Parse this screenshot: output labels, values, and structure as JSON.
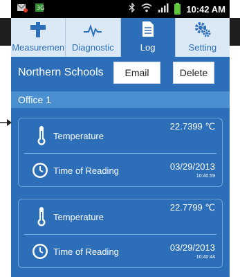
{
  "status_bar": {
    "time": "10:42 AM",
    "icons": [
      "mail-icon",
      "app-icon",
      "bluetooth-icon",
      "wifi-icon",
      "signal-icon",
      "battery-icon"
    ]
  },
  "tabs": [
    {
      "label": "Measuremen",
      "icon": "probe-icon",
      "active": false
    },
    {
      "label": "Diagnostic",
      "icon": "pulse-icon",
      "active": false
    },
    {
      "label": "Log",
      "icon": "document-icon",
      "active": true
    },
    {
      "label": "Setting",
      "icon": "gears-icon",
      "active": false
    }
  ],
  "header": {
    "group_name": "Northern Schools",
    "email_label": "Email",
    "delete_label": "Delete"
  },
  "section": {
    "name": "Office 1"
  },
  "readings": [
    {
      "temperature_label": "Temperature",
      "temperature_value": "22.7399 ℃",
      "time_label": "Time of Reading",
      "date": "03/29/2013",
      "time": "10:40:59"
    },
    {
      "temperature_label": "Temperature",
      "temperature_value": "22.7799 ℃",
      "time_label": "Time of Reading",
      "date": "03/29/2013",
      "time": "10:40:44"
    }
  ],
  "colors": {
    "primary": "#2c6eb7",
    "tab_inactive": "#dbe8f5",
    "section_bar": "#4a8fd0",
    "card_border": "#6ea6dc"
  }
}
